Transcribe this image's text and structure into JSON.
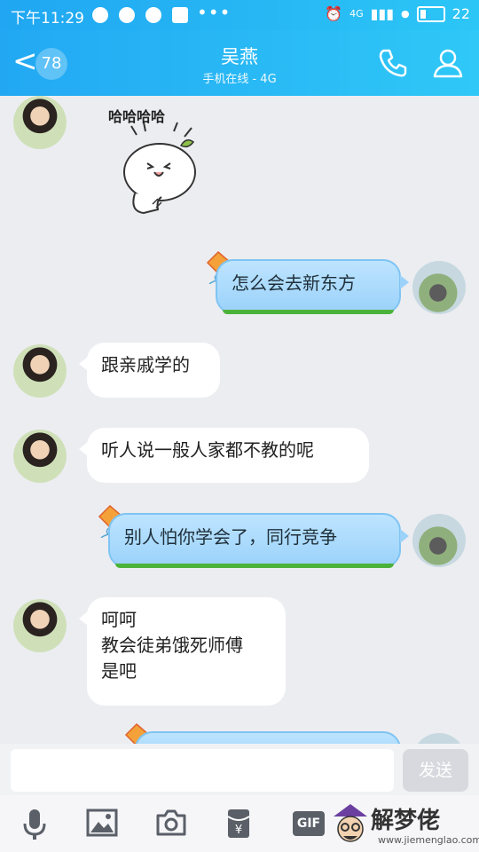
{
  "status_bar": {
    "time": "下午11:29",
    "dots": "•••",
    "network": "4G",
    "battery": "22"
  },
  "header": {
    "unread_badge": "78",
    "contact_name": "吴燕",
    "contact_status": "手机在线 - 4G",
    "icons": [
      "back-chevron-icon",
      "phone-icon",
      "profile-icon"
    ]
  },
  "sticker": {
    "text": "哈哈哈哈"
  },
  "messages": [
    {
      "side": "right",
      "lines": [
        "怎么会去新东方"
      ]
    },
    {
      "side": "left",
      "lines": [
        "跟亲戚学的"
      ]
    },
    {
      "side": "left",
      "lines": [
        "听人说一般人家都不教的呢"
      ]
    },
    {
      "side": "right",
      "lines": [
        "别人怕你学会了，同行竞争"
      ]
    },
    {
      "side": "left",
      "lines": [
        "呵呵",
        "教会徒弟饿死师傅",
        "是吧"
      ]
    }
  ],
  "input": {
    "placeholder": "",
    "send_label": "发送"
  },
  "toolbar": {
    "gif_label": "GIF",
    "icons": [
      "microphone-icon",
      "image-icon",
      "camera-icon",
      "red-envelope-icon",
      "gif-icon"
    ]
  },
  "watermark": {
    "brand": "解梦佬",
    "url": "www.jiemenglao.com"
  },
  "colors": {
    "header_start": "#22a8f3",
    "header_end": "#2fc8f7",
    "chat_bg": "#ecedf1",
    "my_bubble": "#9bd2fa",
    "friend_bubble": "#ffffff"
  }
}
